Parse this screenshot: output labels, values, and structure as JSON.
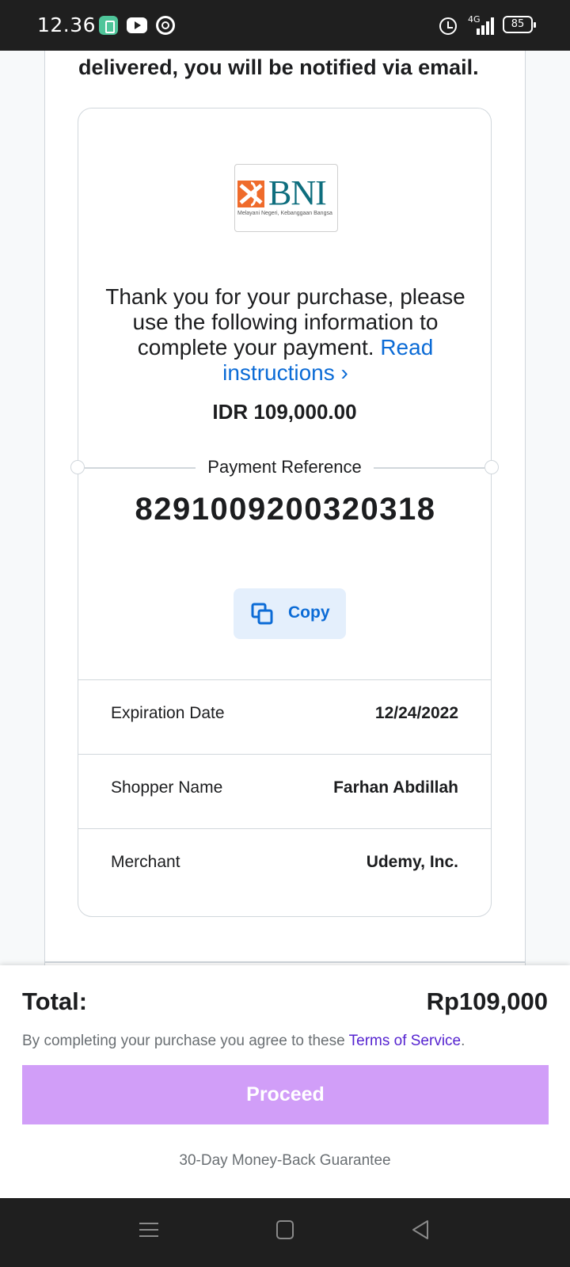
{
  "status_bar": {
    "time": "12.36",
    "network": "4G",
    "battery": "85",
    "icons": [
      "app-icon",
      "youtube-icon",
      "chrome-icon",
      "alarm-icon",
      "signal-icon",
      "battery-icon"
    ]
  },
  "content": {
    "delivered_text": "delivered, you will be notified via email.",
    "bank_logo": {
      "word": "BNI",
      "tagline": "Melayani Negeri, Kebanggaan Bangsa",
      "brand_color": "#0e6e7e",
      "mark_color": "#ef6b2b"
    },
    "thanks_text": "Thank you for your purchase, please use the following information to complete your payment.",
    "instructions_link": "Read instructions ›",
    "amount": "IDR 109,000.00",
    "payment_reference_label": "Payment Reference",
    "payment_reference": "8291009200320318",
    "copy_label": "Copy",
    "details": [
      {
        "key": "Expiration Date",
        "value": "12/24/2022"
      },
      {
        "key": "Shopper Name",
        "value": "Farhan Abdillah"
      },
      {
        "key": "Merchant",
        "value": "Udemy, Inc."
      }
    ]
  },
  "checkout": {
    "total_label": "Total:",
    "total_value": "Rp109,000",
    "terms_text": "By completing your purchase you agree to these ",
    "terms_link": "Terms of Service",
    "terms_suffix": ".",
    "proceed_label": "Proceed",
    "guarantee": "30-Day Money-Back Guarantee",
    "proceed_color": "#d19ef8",
    "link_color": "#5624d0"
  },
  "nav_bar": {
    "buttons": [
      "menu-icon",
      "home-icon",
      "back-icon"
    ]
  }
}
